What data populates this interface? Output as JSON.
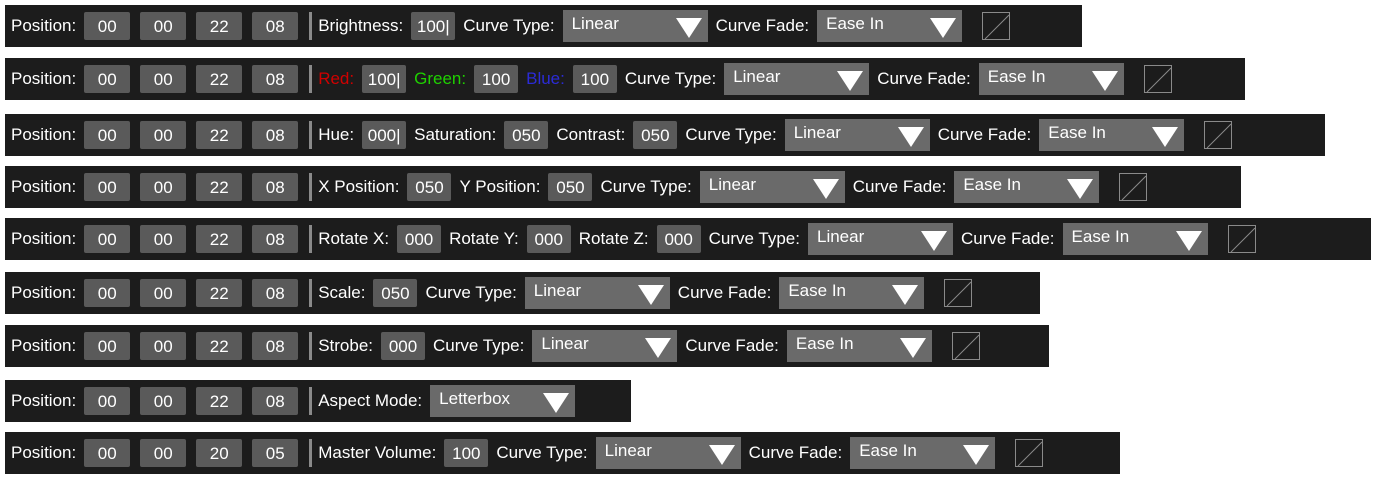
{
  "position_label": "Position:",
  "curve_type_label": "Curve Type:",
  "curve_fade_label": "Curve Fade:",
  "rows": [
    {
      "position": [
        "00",
        "00",
        "22",
        "08"
      ],
      "fields": [
        {
          "label": "Brightness:",
          "value": "100|"
        }
      ],
      "curve_type": "Linear",
      "curve_fade": "Ease In"
    },
    {
      "position": [
        "00",
        "00",
        "22",
        "08"
      ],
      "fields": [
        {
          "label": "Red:",
          "value": "100|"
        },
        {
          "label": "Green:",
          "value": "100"
        },
        {
          "label": "Blue:",
          "value": "100"
        }
      ],
      "curve_type": "Linear",
      "curve_fade": "Ease In"
    },
    {
      "position": [
        "00",
        "00",
        "22",
        "08"
      ],
      "fields": [
        {
          "label": "Hue:",
          "value": "000|"
        },
        {
          "label": "Saturation:",
          "value": "050"
        },
        {
          "label": "Contrast:",
          "value": "050"
        }
      ],
      "curve_type": "Linear",
      "curve_fade": "Ease In"
    },
    {
      "position": [
        "00",
        "00",
        "22",
        "08"
      ],
      "fields": [
        {
          "label": "X Position:",
          "value": "050"
        },
        {
          "label": "Y Position:",
          "value": "050"
        }
      ],
      "curve_type": "Linear",
      "curve_fade": "Ease In"
    },
    {
      "position": [
        "00",
        "00",
        "22",
        "08"
      ],
      "fields": [
        {
          "label": "Rotate X:",
          "value": "000"
        },
        {
          "label": "Rotate Y:",
          "value": "000"
        },
        {
          "label": "Rotate Z:",
          "value": "000"
        }
      ],
      "curve_type": "Linear",
      "curve_fade": "Ease In"
    },
    {
      "position": [
        "00",
        "00",
        "22",
        "08"
      ],
      "fields": [
        {
          "label": "Scale:",
          "value": "050"
        }
      ],
      "curve_type": "Linear",
      "curve_fade": "Ease In"
    },
    {
      "position": [
        "00",
        "00",
        "22",
        "08"
      ],
      "fields": [
        {
          "label": "Strobe:",
          "value": "000"
        }
      ],
      "curve_type": "Linear",
      "curve_fade": "Ease In"
    },
    {
      "position": [
        "00",
        "00",
        "22",
        "08"
      ],
      "aspect_label": "Aspect Mode:",
      "aspect_value": "Letterbox"
    },
    {
      "position": [
        "00",
        "00",
        "20",
        "05"
      ],
      "fields": [
        {
          "label": "Master Volume:",
          "value": "100"
        }
      ],
      "curve_type": "Linear",
      "curve_fade": "Ease In"
    }
  ],
  "colors": {
    "background": "#1c1c1c",
    "field": "#5a5a5a",
    "dropdown": "#6a6a6a",
    "red": "#d00000",
    "green": "#1fd000",
    "blue": "#2b2bd6"
  },
  "icons": [
    "dropdown-arrow-icon",
    "linear-curve-icon"
  ]
}
